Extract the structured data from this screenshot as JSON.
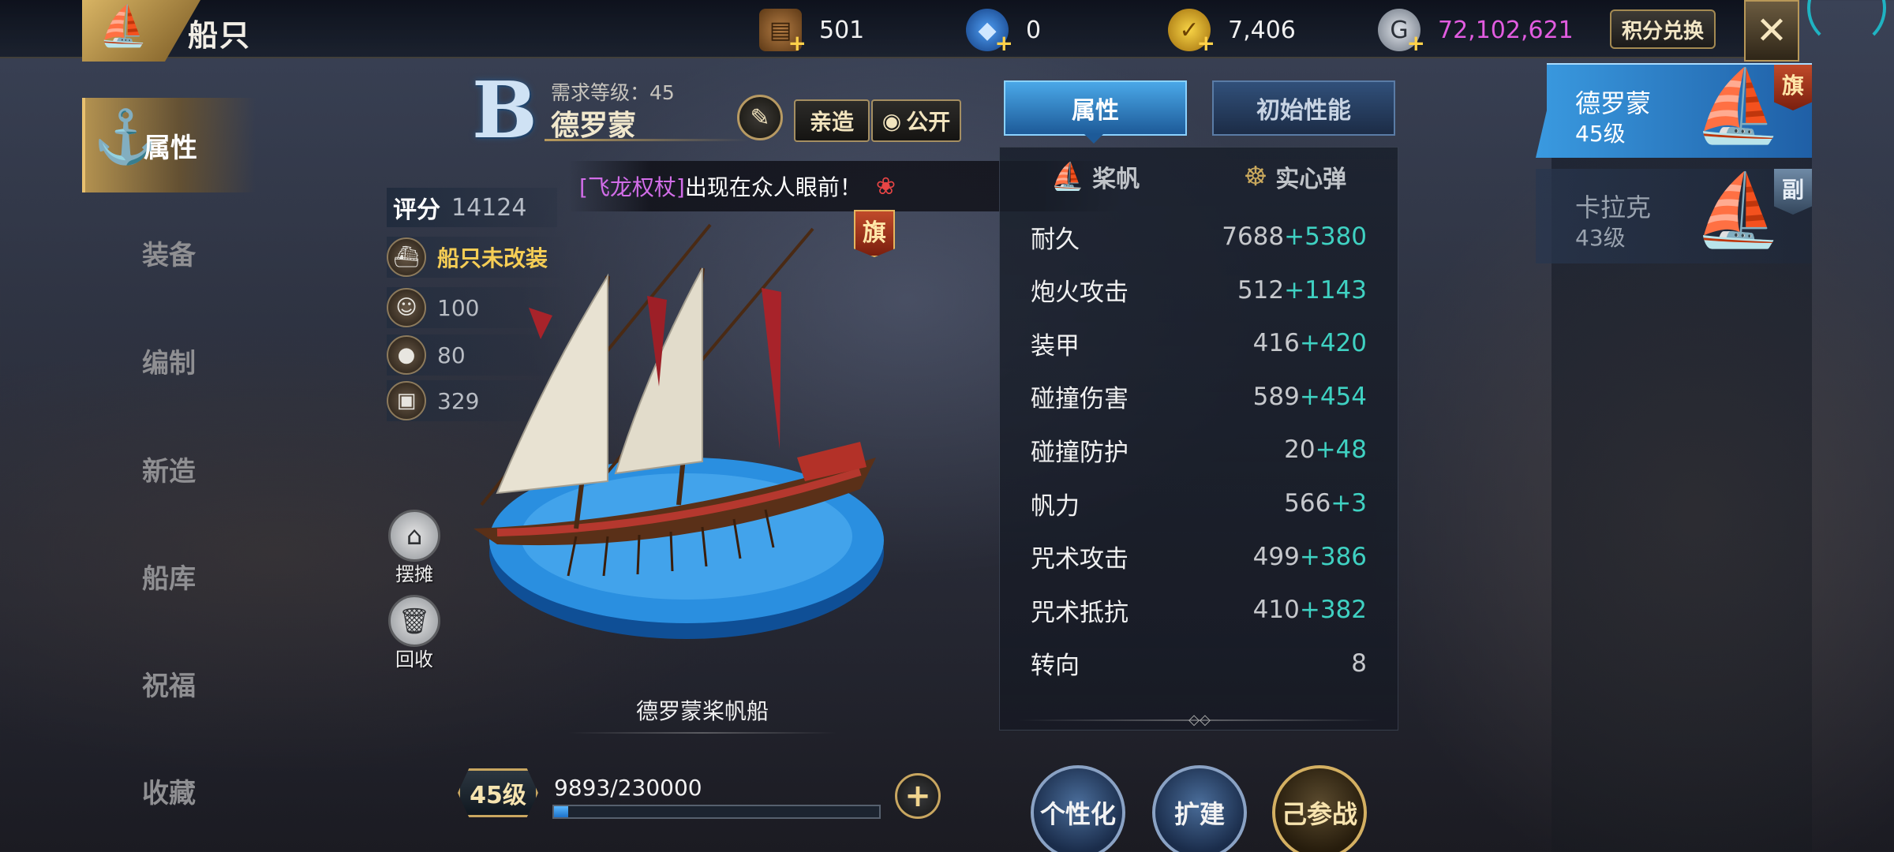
{
  "window": {
    "title": "船只"
  },
  "resources": [
    {
      "name": "wood",
      "icon": "wood-crate-icon",
      "value": "501"
    },
    {
      "name": "gem",
      "icon": "blue-gem-icon",
      "value": "0"
    },
    {
      "name": "gold",
      "icon": "gold-coin-icon",
      "value": "7,406"
    },
    {
      "name": "silver",
      "icon": "silver-coin-icon",
      "value": "72,102,621",
      "color": "#e25ce0"
    }
  ],
  "header_buttons": {
    "exchange": "积分兑换",
    "close": "✕"
  },
  "nav": {
    "items": [
      {
        "label": "属性",
        "active": true
      },
      {
        "label": "装备"
      },
      {
        "label": "编制"
      },
      {
        "label": "新造"
      },
      {
        "label": "船库"
      },
      {
        "label": "祝福"
      },
      {
        "label": "收藏"
      }
    ]
  },
  "ship": {
    "grade": "B",
    "required_level": "需求等级：45",
    "name": "德罗蒙",
    "btn_build": "亲造",
    "btn_public": "公开",
    "score_label": "评分",
    "score_value": "14124",
    "modify_status": "船只未改装",
    "stats": [
      {
        "icon": "sailor-icon",
        "value": "100"
      },
      {
        "icon": "food-icon",
        "value": "80"
      },
      {
        "icon": "cargo-icon",
        "value": "329"
      }
    ],
    "side_actions": [
      {
        "icon": "stall-icon",
        "label": "摆摊"
      },
      {
        "icon": "recycle-bin-icon",
        "label": "回收"
      }
    ],
    "flag_tag": "旗",
    "caption": "德罗蒙桨帆船",
    "level_badge": "45级",
    "exp_text": "9893/230000",
    "exp_fraction": 0.043
  },
  "announcement": {
    "highlight": "[飞龙权杖]",
    "text": "出现在众人眼前！"
  },
  "attributes": {
    "tabs": [
      "属性",
      "初始性能"
    ],
    "weapons": [
      "桨帆",
      "实心弹"
    ],
    "rows": [
      {
        "name": "耐久",
        "base": "7688",
        "bonus": "+5380"
      },
      {
        "name": "炮火攻击",
        "base": "512",
        "bonus": "+1143"
      },
      {
        "name": "装甲",
        "base": "416",
        "bonus": "+420"
      },
      {
        "name": "碰撞伤害",
        "base": "589",
        "bonus": "+454"
      },
      {
        "name": "碰撞防护",
        "base": "20",
        "bonus": "+48"
      },
      {
        "name": "帆力",
        "base": "566",
        "bonus": "+3"
      },
      {
        "name": "咒术攻击",
        "base": "499",
        "bonus": "+386"
      },
      {
        "name": "咒术抵抗",
        "base": "410",
        "bonus": "+382"
      },
      {
        "name": "转向",
        "base": "8",
        "bonus": ""
      }
    ]
  },
  "action_buttons": [
    "个性化",
    "扩建",
    "己参战"
  ],
  "ship_list": [
    {
      "name": "德罗蒙",
      "level": "45级",
      "tag": "旗",
      "active": true
    },
    {
      "name": "卡拉克",
      "level": "43级",
      "tag": "副",
      "active": false
    }
  ],
  "colors": {
    "accent_blue": "#3a9ae0",
    "bonus_teal": "#3fd1c2",
    "gold": "#f5cd55",
    "announce_purple": "#d26de8"
  }
}
